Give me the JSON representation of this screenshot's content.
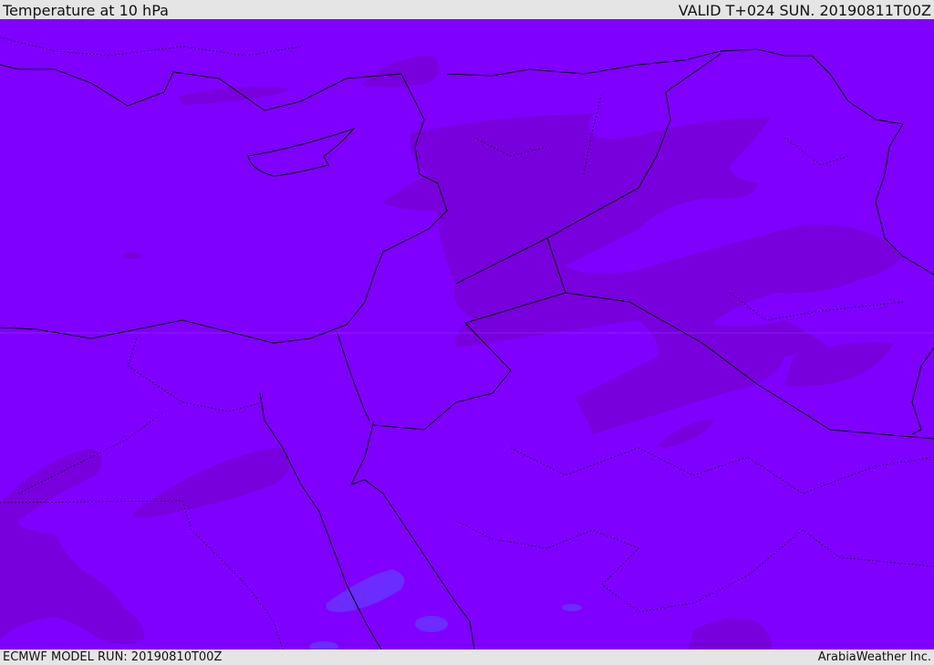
{
  "header": {
    "title": "Temperature at 10 hPa",
    "valid": "VALID T+024 SUN. 20190811T00Z"
  },
  "footer": {
    "model_run": "ECMWF MODEL RUN: 20190810T00Z",
    "credit": "ArabiaWeather Inc."
  },
  "colors": {
    "base_field": "#7f00ff",
    "warm_field": "#7800dc",
    "cool_field": "#6a2cff",
    "header_bg": "#e5e5e5",
    "borders": "#000000"
  }
}
